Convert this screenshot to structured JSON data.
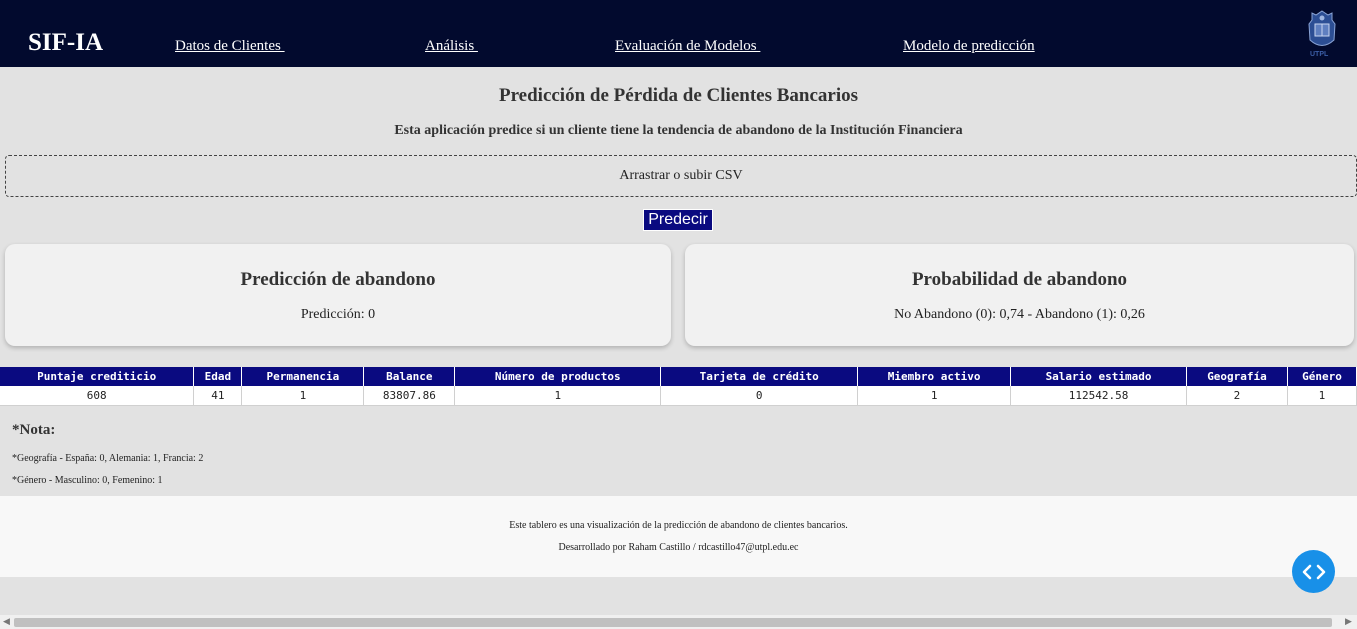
{
  "nav": {
    "brand": "SIF-IA",
    "links": [
      "Datos de Clientes ",
      "Análisis ",
      "Evaluación de Modelos ",
      "Modelo de predicción"
    ],
    "logo_text": "UTPL"
  },
  "header": {
    "title": "Predicción de Pérdida de Clientes Bancarios",
    "subtitle": "Esta aplicación predice si un cliente tiene la tendencia de abandono de la Institución Financiera"
  },
  "upload": {
    "label": "Arrastrar o subir CSV"
  },
  "predict_button": "Predecir",
  "cards": {
    "prediction": {
      "title": "Predicción de abandono",
      "text": "Predicción: 0"
    },
    "probability": {
      "title": "Probabilidad de abandono",
      "text": "No Abandono (0): 0,74 - Abandono (1): 0,26"
    }
  },
  "table": {
    "headers": [
      "Puntaje crediticio",
      "Edad",
      "Permanencia",
      "Balance",
      "Número de productos",
      "Tarjeta de crédito",
      "Miembro activo",
      "Salario estimado",
      "Geografía",
      "Género"
    ],
    "rows": [
      [
        "608",
        "41",
        "1",
        "83807.86",
        "1",
        "0",
        "1",
        "112542.58",
        "2",
        "1"
      ]
    ]
  },
  "notes": {
    "title": "*Nota:",
    "lines": [
      "*Geografía - España: 0, Alemania: 1, Francia: 2",
      "*Género - Masculino: 0, Femenino: 1"
    ]
  },
  "footer": {
    "line1": "Este tablero es una visualización de la predicción de abandono de clientes bancarios.",
    "line2": "Desarrollado por Raham Castillo / rdcastillo47@utpl.edu.ec"
  },
  "colors": {
    "navbar": "#020a2e",
    "accent": "#0a0a80",
    "toggle": "#1890e8"
  },
  "icons": {
    "toggle": "code-brackets-icon",
    "logo": "university-crest-icon"
  }
}
